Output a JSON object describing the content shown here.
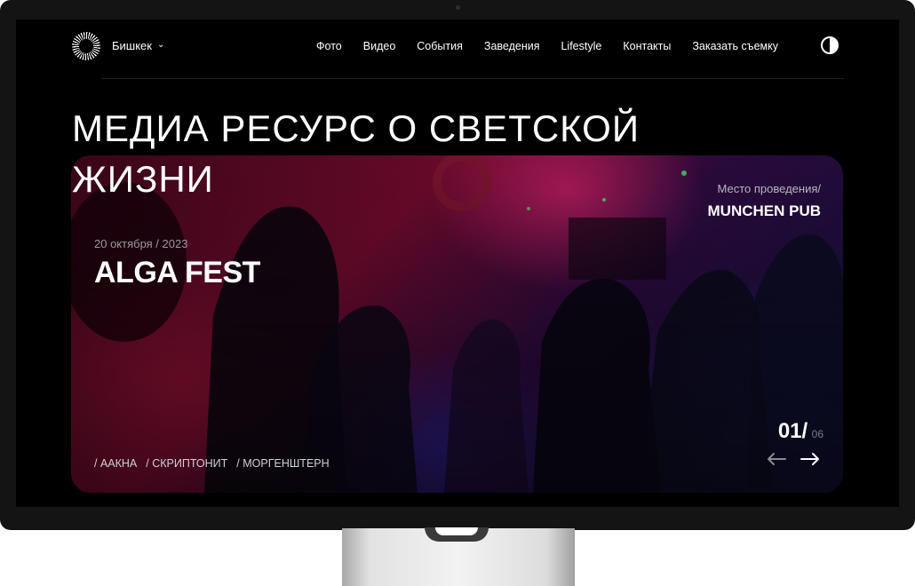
{
  "header": {
    "city": "Бишкек",
    "nav": [
      "Фото",
      "Видео",
      "События",
      "Заведения",
      "Lifestyle",
      "Контакты",
      "Заказать съемку"
    ]
  },
  "headline": {
    "line1": "МЕДИА РЕСУРС О СВЕТСКОЙ",
    "line2": "ЖИЗНИ"
  },
  "event": {
    "date": "20 октября / 2023",
    "title": "ALGA FEST",
    "venue_label": "Место проведения/",
    "venue_name": "MUNCHEN PUB",
    "artists": [
      "/ ААКНА",
      "/ СКРИПТОНИТ",
      "/ МОРГЕНШТЕРН"
    ]
  },
  "slider": {
    "current": "01/",
    "total": "06"
  },
  "colors": {
    "background": "#000000",
    "text": "#ffffff",
    "muted": "#9a9aa0",
    "accent_magenta": "#c2185b",
    "accent_blue": "#2a3ad8"
  },
  "icons": {
    "logo": "sunburst-logo-icon",
    "city_dropdown": "chevron-down-icon",
    "theme": "contrast-toggle-icon",
    "prev": "arrow-left-icon",
    "next": "arrow-right-icon"
  }
}
